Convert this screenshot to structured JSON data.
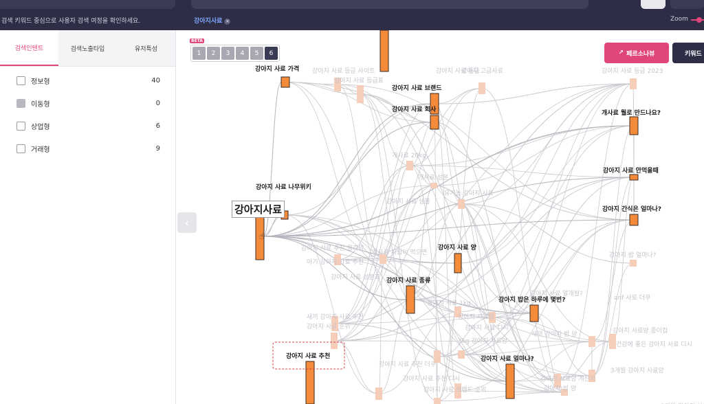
{
  "header": {
    "hint": "검색 키워드 중심으로 사용자 검색 여정을 확인하세요.",
    "chip_label": "강아지사료",
    "chip_close": "×",
    "zoom_label": "Zoom"
  },
  "sidebar": {
    "tabs": [
      "검색인텐트",
      "검색노출타입",
      "유저특성"
    ],
    "filters": [
      {
        "label": "정보형",
        "count": "40"
      },
      {
        "label": "이동형",
        "count": "0"
      },
      {
        "label": "상업형",
        "count": "6"
      },
      {
        "label": "거래형",
        "count": "9"
      }
    ],
    "collapse_icon": "‹"
  },
  "graph": {
    "beta_label": "BETA",
    "steps": [
      "1",
      "2",
      "3",
      "4",
      "5",
      "6"
    ],
    "active_step": "6",
    "persona_button": "페르소나뷰",
    "keyword_button": "키워드",
    "main_keyword": "강아지사료",
    "selected_keyword": "강아지 사료 추천",
    "strong_labels": [
      "강아지 사료 가격",
      "강아지 사료 브랜드",
      "강아지 사료 회사",
      "개사료 뭘로 만드나요?",
      "강아지 사료 안먹을때",
      "강아지 간식은 얼마나?",
      "강아지 사료 나무위키",
      "강아지 사료 양",
      "강아지 사료 종류",
      "강아지 밥은 하루에 몇번?",
      "강아지 사료 얼마나?"
    ],
    "faint_labels": [
      "강아지 사료 등급 사이트",
      "강아지 사료 등급표",
      "강아지 사료 등급",
      "강아지 고급사료",
      "강아지 사료 등급 2023",
      "개사료 20kg",
      "개사료 성분",
      "유기농 강아지 사료",
      "강아지 사료 샘플",
      "강아지 사료 추천 퀄리앙",
      "개사료 사람이 먹으면",
      "아기 강아지 사료 추천",
      "강아지 사료 성분표",
      "강아지 밥 얼마나?",
      "강아지 사료 얼개월?",
      "anf 사료 더쿠",
      "새끼 강아지 사료 추천",
      "강아지 사료 순위",
      "강아지 사료 1kg",
      "강아지 사료량",
      "3kg 강아지 사료양",
      "새끼 강아지 밥 양",
      "3개월 강아지 사료양",
      "강아지 사료양 종이컵",
      "건강에 좋은 강아지 사료 디시",
      "강아지 사료 추천 더쿠",
      "강아지 사료 추천 디시",
      "강아지 사료 브랜드 순위",
      "강아지 사료양 계산기",
      "강아지 밥 양",
      "3개월 강아지 사료양",
      "강아지 사료 디시"
    ]
  }
}
